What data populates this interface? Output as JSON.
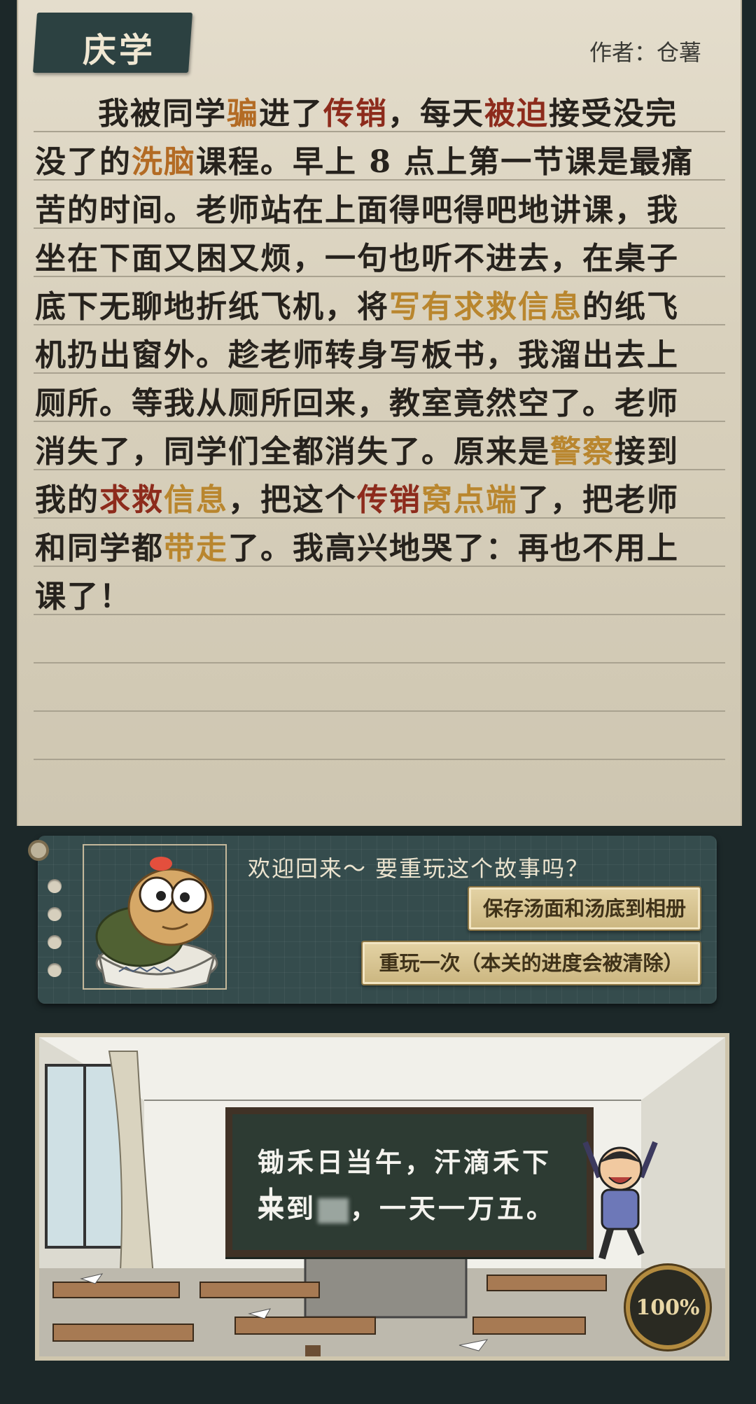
{
  "title": "庆学",
  "author": "作者：仓薯",
  "story": {
    "segments": [
      {
        "t": "我被同学",
        "c": ""
      },
      {
        "t": "骗",
        "c": "hl-org"
      },
      {
        "t": "进了",
        "c": ""
      },
      {
        "t": "传销",
        "c": "hl-red"
      },
      {
        "t": "，每天",
        "c": ""
      },
      {
        "t": "被迫",
        "c": "hl-red"
      },
      {
        "t": "接受没完没了的",
        "c": ""
      },
      {
        "t": "洗脑",
        "c": "hl-org"
      },
      {
        "t": "课程。早上 8 点上第一节课是最痛苦的时间。老师站在上面得吧得吧地讲课，我坐在下面又困又烦，一句也听不进去，在桌子底下无聊地折纸飞机，将",
        "c": ""
      },
      {
        "t": "写有求救信息",
        "c": "hl-gold"
      },
      {
        "t": "的纸飞机扔出窗外。趁老师转身写板书，我溜出去上厕所。等我从厕所回来，教室竟然空了。老师消失了，同学们全都消失了。原来是",
        "c": ""
      },
      {
        "t": "警察",
        "c": "hl-gold"
      },
      {
        "t": "接到我的",
        "c": ""
      },
      {
        "t": "求救",
        "c": "hl-red"
      },
      {
        "t": "信息",
        "c": "hl-gold"
      },
      {
        "t": "，把这个",
        "c": ""
      },
      {
        "t": "传销",
        "c": "hl-red"
      },
      {
        "t": "窝点端",
        "c": "hl-gold"
      },
      {
        "t": "了，把老师和同学都",
        "c": ""
      },
      {
        "t": "带走",
        "c": "hl-gold"
      },
      {
        "t": "了。我高兴地哭了：再也不用上课了！",
        "c": ""
      }
    ]
  },
  "dialog": {
    "welcome": "欢迎回来～ 要重玩这个故事吗？",
    "save_button": "保存汤面和汤底到相册",
    "replay_button": "重玩一次（本关的进度会被清除）"
  },
  "scene": {
    "board_line1": "锄禾日当午，汗滴禾下土。",
    "board_line2_prefix": "来到",
    "board_line2_suffix": "，一天一万五。",
    "progress_label": "100%",
    "progress_value": 1.0
  }
}
